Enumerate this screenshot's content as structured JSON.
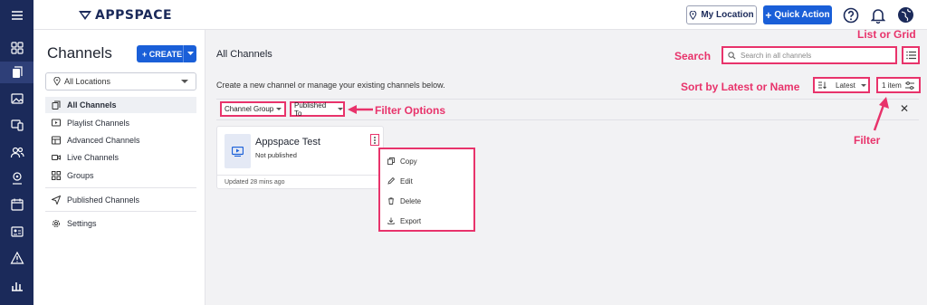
{
  "colors": {
    "rail_bg": "#1b2a5a",
    "accent_blue": "#1a5fd8",
    "annotation_pink": "#e8336b",
    "page_bg": "#f2f2f4"
  },
  "rail": {
    "items": [
      {
        "icon": "hamburger-menu-icon"
      },
      {
        "icon": "dashboard-icon"
      },
      {
        "icon": "channels-icon",
        "active": true
      },
      {
        "icon": "media-icon"
      },
      {
        "icon": "devices-icon"
      },
      {
        "icon": "users-icon"
      },
      {
        "icon": "location-icon"
      },
      {
        "icon": "calendar-icon"
      },
      {
        "icon": "id-card-icon"
      },
      {
        "icon": "alert-icon"
      },
      {
        "icon": "analytics-icon"
      }
    ]
  },
  "topbar": {
    "logo": "APPSPACE",
    "my_location_label": "My Location",
    "quick_action_label": "Quick Action",
    "icons": [
      "help-icon",
      "notification-bell-icon",
      "globe-avatar-icon"
    ]
  },
  "sidebar": {
    "title": "Channels",
    "create_label": "CREATE",
    "location_value": "All Locations",
    "items": [
      {
        "label": "All Channels",
        "icon": "channels-icon",
        "active": true
      },
      {
        "label": "Playlist Channels",
        "icon": "playlist-icon"
      },
      {
        "label": "Advanced Channels",
        "icon": "advanced-channels-icon"
      },
      {
        "label": "Live Channels",
        "icon": "live-camera-icon"
      },
      {
        "label": "Groups",
        "icon": "groups-icon"
      },
      {
        "label": "Published Channels",
        "icon": "send-icon"
      },
      {
        "label": "Settings",
        "icon": "gear-icon"
      }
    ]
  },
  "main": {
    "title": "All Channels",
    "subtitle": "Create a new channel or manage your existing channels below.",
    "search_placeholder": "Search in all channels",
    "sort_value": "Latest",
    "item_count": "1 item",
    "filters": [
      "Channel Group",
      "Published To"
    ],
    "card": {
      "title": "Appspace Test",
      "status": "Not published",
      "updated": "Updated 28 mins ago"
    },
    "context_menu": [
      "Copy",
      "Edit",
      "Delete",
      "Export"
    ]
  },
  "annotations": {
    "list_or_grid": "List or Grid",
    "search": "Search",
    "sort": "Sort by Latest or Name",
    "filter_options": "Filter Options",
    "filter": "Filter"
  }
}
